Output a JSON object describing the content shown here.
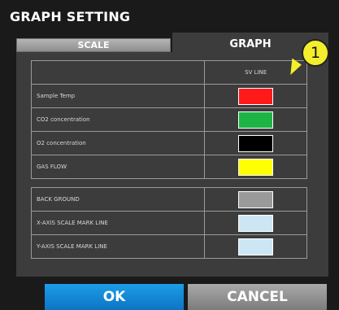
{
  "dialog": {
    "title": "GRAPH SETTING"
  },
  "tabs": {
    "scale_label": "SCALE",
    "graph_label": "GRAPH"
  },
  "callout": {
    "number": "1"
  },
  "table": {
    "column_header": "SV LINE",
    "rows": [
      {
        "label": "Sample Temp",
        "color": "#ff1a1a"
      },
      {
        "label": "CO2 concentration",
        "color": "#1db445"
      },
      {
        "label": "O2 concentration",
        "color": "#000000"
      },
      {
        "label": "GAS FLOW",
        "color": "#ffff00"
      }
    ],
    "background_rows": [
      {
        "label": "BACK GROUND",
        "color": "#9a9a9a"
      },
      {
        "label": "X-AXIS SCALE MARK LINE",
        "color": "#cce6f4"
      },
      {
        "label": "Y-AXIS SCALE MARK LINE",
        "color": "#cce6f4"
      }
    ]
  },
  "buttons": {
    "ok": "OK",
    "cancel": "CANCEL"
  }
}
